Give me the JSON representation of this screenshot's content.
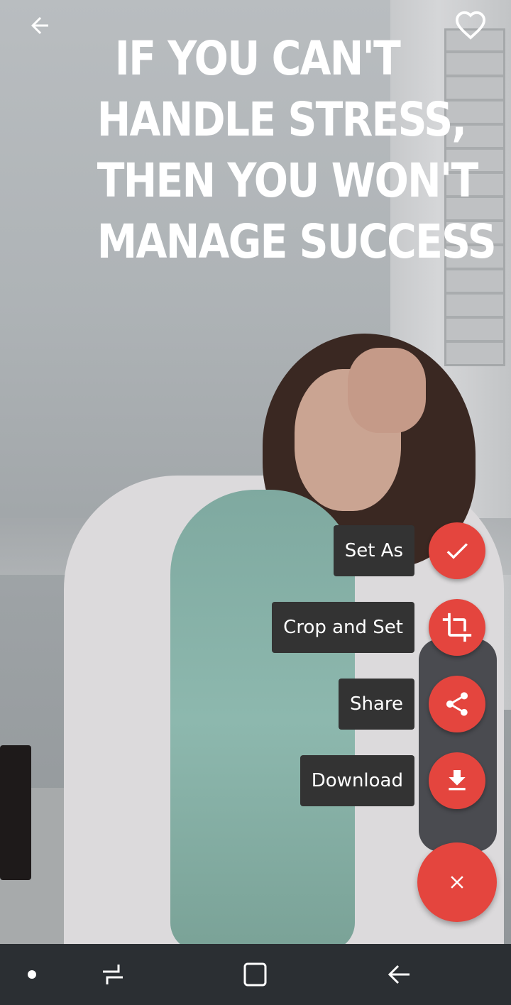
{
  "quote": {
    "lines": [
      "IF YOU CAN'T",
      "HANDLE STRESS,",
      "THEN YOU WON'T",
      "MANAGE SUCCESS"
    ]
  },
  "actions": {
    "set_as": "Set As",
    "crop_and_set": "Crop and Set",
    "share": "Share",
    "download": "Download"
  },
  "icons": {
    "back": "back-arrow-icon",
    "favorite": "heart-outline-icon",
    "set_as": "check-icon",
    "crop": "crop-icon",
    "share": "share-icon",
    "download": "download-icon",
    "close": "close-icon"
  },
  "colors": {
    "accent": "#e4453e",
    "label_bg": "#333333",
    "navbar": "#2b2f33"
  }
}
